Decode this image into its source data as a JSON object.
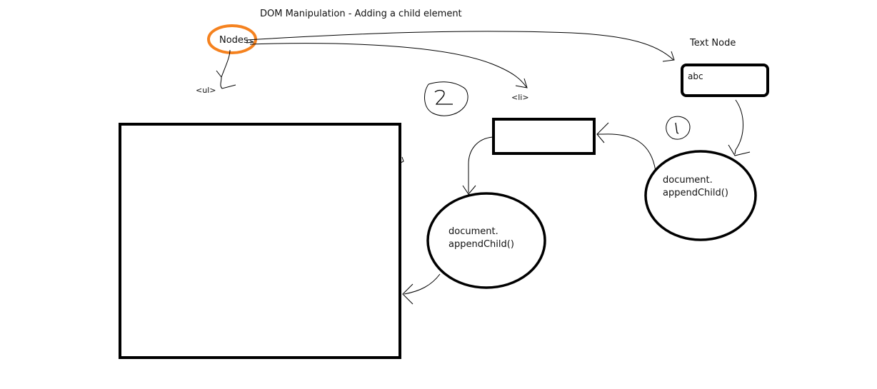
{
  "title": "DOM Manipulation - Adding a child element",
  "nodes_label": "Nodes",
  "ul_label": "<ul>",
  "li_label": "<li>",
  "text_node_label": "Text Node",
  "text_node_value": "abc",
  "step1_call": {
    "line1": "document.",
    "line2": "appendChild()"
  },
  "step2_call": {
    "line1": "document.",
    "line2": "appendChild()"
  },
  "colors": {
    "stroke": "#000000",
    "highlight": "#f5821f",
    "background": "#ffffff"
  }
}
